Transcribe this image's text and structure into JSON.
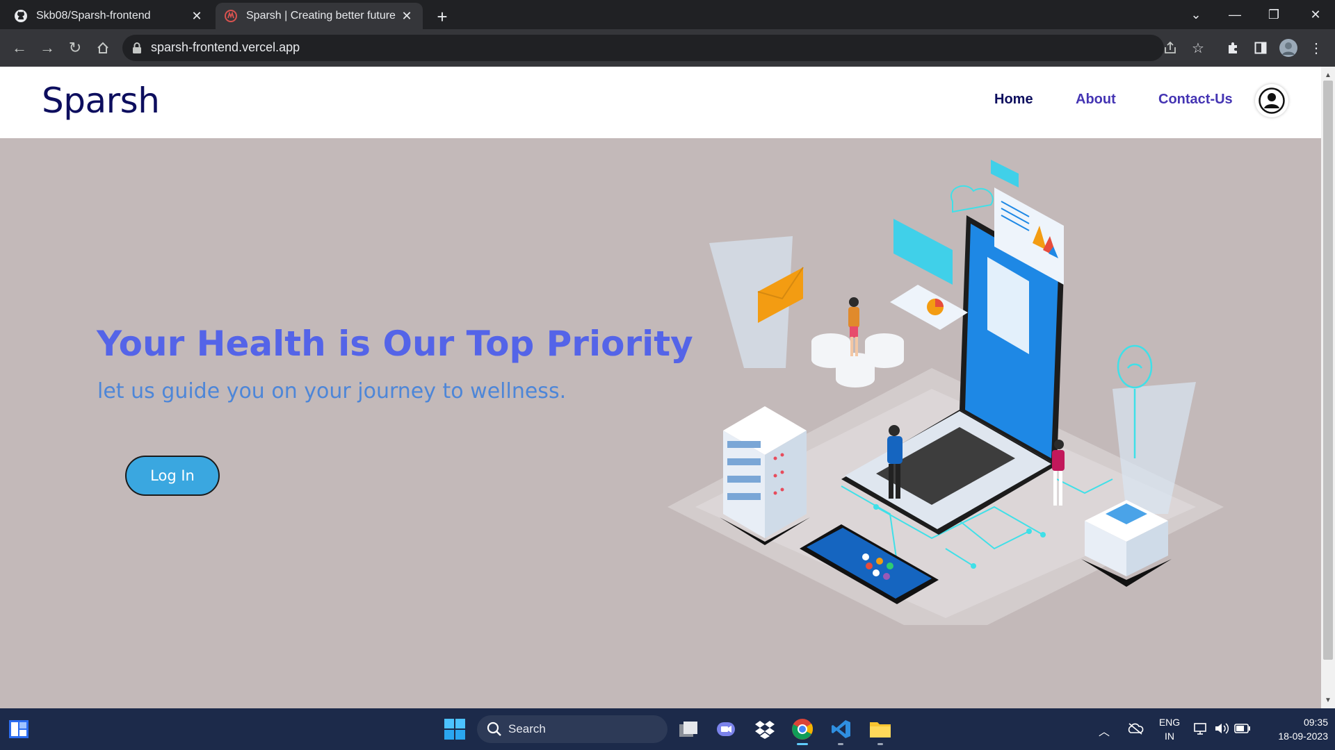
{
  "browser": {
    "tabs": [
      {
        "title": "Skb08/Sparsh-frontend",
        "icon": "github-icon"
      },
      {
        "title": "Sparsh | Creating better future",
        "icon": "sparsh-favicon"
      }
    ],
    "url": "sparsh-frontend.vercel.app"
  },
  "site": {
    "brand": "Sparsh",
    "nav": {
      "home": "Home",
      "about": "About",
      "contact": "Contact-Us"
    },
    "hero": {
      "title": "Your Health is Our Top Priority",
      "subtitle": "let us guide you on your journey to wellness.",
      "login": "Log In"
    }
  },
  "taskbar": {
    "search_placeholder": "Search",
    "lang_line1": "ENG",
    "lang_line2": "IN",
    "time": "09:35",
    "date": "18-09-2023"
  },
  "colors": {
    "page_bg": "#c3b9b9",
    "brand": "#0d0e5e",
    "nav_link": "#4434b3",
    "hero_title": "#5464e8",
    "hero_sub": "#4d86d8",
    "login_btn": "#3aa7e0"
  }
}
